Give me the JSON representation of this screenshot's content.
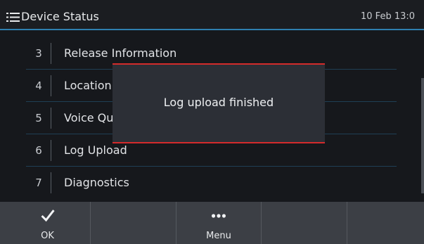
{
  "header": {
    "title": "Device Status",
    "datetime": "10 Feb 13:0",
    "menu_icon": "list-menu-icon",
    "accent_color": "#2f7fb0"
  },
  "list": {
    "items": [
      {
        "number": "3",
        "label": "Release Information"
      },
      {
        "number": "4",
        "label": "Location"
      },
      {
        "number": "5",
        "label": "Voice Qu"
      },
      {
        "number": "6",
        "label": "Log Upload"
      },
      {
        "number": "7",
        "label": "Diagnostics"
      }
    ]
  },
  "popup": {
    "message": "Log upload finished",
    "border_color": "#d42b2b"
  },
  "softkeys": [
    {
      "label": "OK",
      "icon": "checkmark-icon"
    },
    {
      "label": "",
      "icon": ""
    },
    {
      "label": "Menu",
      "icon": "more-dots-icon"
    },
    {
      "label": "",
      "icon": ""
    },
    {
      "label": "",
      "icon": ""
    }
  ]
}
